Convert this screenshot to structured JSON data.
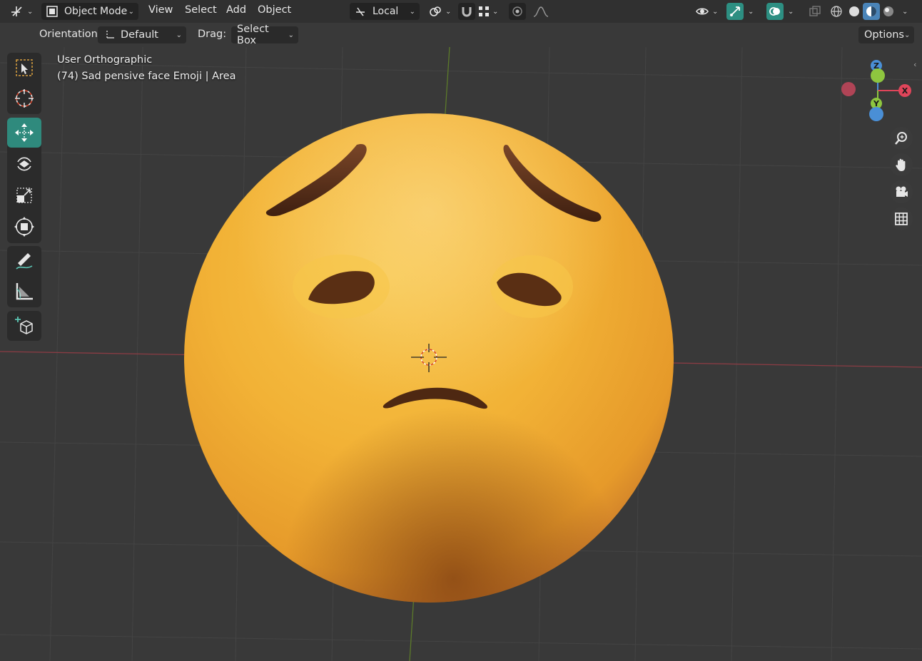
{
  "header": {
    "editor_type_icon": "axis-gizmo-icon",
    "mode_label": "Object Mode",
    "menus": [
      "View",
      "Select",
      "Add",
      "Object"
    ],
    "transform_orientation": "Local",
    "icons": {
      "pivot": "pivot-link-icon",
      "snap": "magnet-icon",
      "snap_target": "grid-snap-icon",
      "proportional": "proportional-editing-icon",
      "falloff": "falloff-curve-icon",
      "visibility": "eye-icon",
      "gizmo": "gizmo-icon",
      "overlays": "overlays-icon",
      "xray": "xray-icon",
      "shading_wire": "wireframe-shading-icon",
      "shading_solid": "solid-shading-icon",
      "shading_material": "material-preview-icon",
      "shading_rendered": "rendered-shading-icon"
    }
  },
  "tool_settings": {
    "orientation_label": "Orientation:",
    "orientation_value": "Default",
    "drag_label": "Drag:",
    "drag_value": "Select Box",
    "options_label": "Options"
  },
  "viewport": {
    "view_name": "User Orthographic",
    "object_info": "(74) Sad pensive face Emoji | Area"
  },
  "tools": [
    {
      "name": "select-box-tool",
      "icon": "select-box-icon",
      "active": false
    },
    {
      "name": "cursor-tool",
      "icon": "cursor-icon",
      "active": false
    },
    {
      "name": "move-tool",
      "icon": "move-icon",
      "active": true
    },
    {
      "name": "rotate-tool",
      "icon": "rotate-icon",
      "active": false
    },
    {
      "name": "scale-tool",
      "icon": "scale-icon",
      "active": false
    },
    {
      "name": "transform-tool",
      "icon": "transform-icon",
      "active": false
    },
    {
      "name": "annotate-tool",
      "icon": "annotate-icon",
      "active": false
    },
    {
      "name": "measure-tool",
      "icon": "measure-icon",
      "active": false
    },
    {
      "name": "add-cube-tool",
      "icon": "add-cube-icon",
      "active": false
    }
  ],
  "nav_gizmo": {
    "axes": [
      "Z",
      "X",
      "Y"
    ],
    "colors": {
      "x": "#e0455a",
      "y": "#8ec63f",
      "z": "#4a8fd6"
    }
  },
  "nav_buttons": [
    "zoom-icon",
    "hand-pan-icon",
    "camera-icon",
    "grid-view-icon"
  ],
  "colors": {
    "header_bg": "#303030",
    "viewport_bg": "#393939",
    "active_tool": "#2f8a7d",
    "emoji_face": "#f2b33a",
    "emoji_features": "#5a2f1a"
  }
}
